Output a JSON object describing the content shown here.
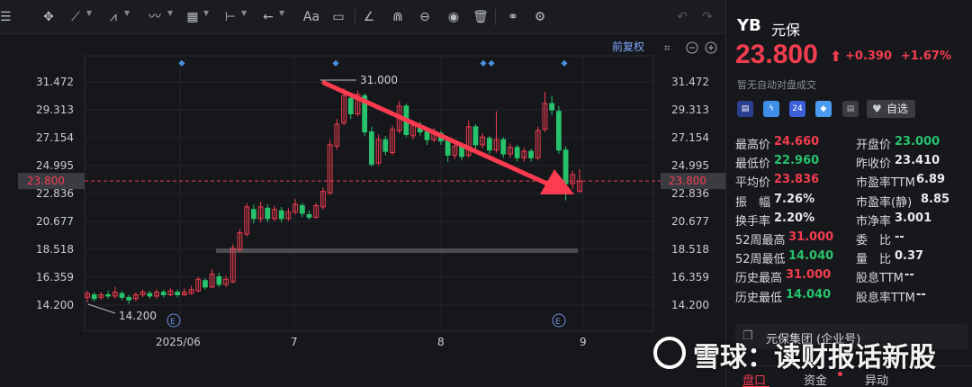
{
  "toolbar": {
    "text_tool_label": "Aa"
  },
  "chart": {
    "adjust_label": "前复权",
    "price_marker": "23.800",
    "max_label": "31.000",
    "min_label": "14.200",
    "event_marker": "E",
    "colors": {
      "up": "#f23d4f",
      "down": "#27c26b",
      "arrow": "#ff3b4f",
      "grid": "#23252b"
    }
  },
  "chart_data": {
    "type": "candlestick",
    "y_ticks_left": [
      "31.472",
      "29.313",
      "27.154",
      "24.995",
      "22.836",
      "20.677",
      "18.518",
      "16.359",
      "14.200"
    ],
    "y_ticks_right": [
      "31.472",
      "29.313",
      "27.154",
      "24.995",
      "22.836",
      "20.677",
      "18.518",
      "16.359",
      "14.200"
    ],
    "x_ticks": [
      "2025/06",
      "7",
      "8",
      "9"
    ],
    "ylim": [
      14.2,
      31.472
    ],
    "current_price": 23.8,
    "high_label": 31.0,
    "low_label": 14.2,
    "candles": [
      {
        "o": 14.8,
        "c": 15.1,
        "h": 15.3,
        "l": 14.4
      },
      {
        "o": 15.0,
        "c": 14.7,
        "h": 15.2,
        "l": 14.5
      },
      {
        "o": 14.8,
        "c": 15.0,
        "h": 15.2,
        "l": 14.6
      },
      {
        "o": 15.0,
        "c": 14.9,
        "h": 15.3,
        "l": 14.7
      },
      {
        "o": 14.9,
        "c": 15.2,
        "h": 15.6,
        "l": 14.7
      },
      {
        "o": 15.1,
        "c": 14.8,
        "h": 15.3,
        "l": 14.6
      },
      {
        "o": 14.8,
        "c": 14.6,
        "h": 15.0,
        "l": 14.3
      },
      {
        "o": 14.7,
        "c": 15.0,
        "h": 15.2,
        "l": 14.5
      },
      {
        "o": 15.0,
        "c": 15.2,
        "h": 15.4,
        "l": 14.8
      },
      {
        "o": 15.1,
        "c": 14.9,
        "h": 15.3,
        "l": 14.7
      },
      {
        "o": 14.9,
        "c": 15.2,
        "h": 15.4,
        "l": 14.7
      },
      {
        "o": 15.2,
        "c": 15.0,
        "h": 15.4,
        "l": 14.8
      },
      {
        "o": 15.0,
        "c": 15.3,
        "h": 15.5,
        "l": 14.9
      },
      {
        "o": 15.2,
        "c": 15.0,
        "h": 15.4,
        "l": 14.8
      },
      {
        "o": 15.0,
        "c": 15.2,
        "h": 15.5,
        "l": 14.9
      },
      {
        "o": 15.1,
        "c": 15.4,
        "h": 15.7,
        "l": 15.0
      },
      {
        "o": 15.3,
        "c": 16.2,
        "h": 16.4,
        "l": 15.2
      },
      {
        "o": 16.1,
        "c": 15.6,
        "h": 16.3,
        "l": 15.4
      },
      {
        "o": 15.6,
        "c": 16.6,
        "h": 17.0,
        "l": 15.5
      },
      {
        "o": 16.4,
        "c": 15.8,
        "h": 16.7,
        "l": 15.6
      },
      {
        "o": 15.8,
        "c": 16.2,
        "h": 16.5,
        "l": 15.6
      },
      {
        "o": 16.0,
        "c": 18.6,
        "h": 18.9,
        "l": 15.9
      },
      {
        "o": 18.5,
        "c": 19.8,
        "h": 20.1,
        "l": 18.3
      },
      {
        "o": 19.7,
        "c": 21.8,
        "h": 22.1,
        "l": 19.5
      },
      {
        "o": 21.6,
        "c": 20.9,
        "h": 22.0,
        "l": 20.5
      },
      {
        "o": 20.9,
        "c": 21.8,
        "h": 22.2,
        "l": 20.6
      },
      {
        "o": 21.7,
        "c": 20.9,
        "h": 22.0,
        "l": 20.6
      },
      {
        "o": 20.9,
        "c": 21.6,
        "h": 21.9,
        "l": 20.7
      },
      {
        "o": 21.5,
        "c": 20.9,
        "h": 21.8,
        "l": 20.6
      },
      {
        "o": 20.9,
        "c": 21.4,
        "h": 21.7,
        "l": 20.7
      },
      {
        "o": 21.4,
        "c": 22.0,
        "h": 22.4,
        "l": 21.2
      },
      {
        "o": 21.9,
        "c": 21.3,
        "h": 22.1,
        "l": 21.0
      },
      {
        "o": 21.2,
        "c": 21.0,
        "h": 21.5,
        "l": 20.8
      },
      {
        "o": 21.0,
        "c": 21.9,
        "h": 22.1,
        "l": 20.9
      },
      {
        "o": 21.8,
        "c": 23.0,
        "h": 23.3,
        "l": 21.6
      },
      {
        "o": 22.9,
        "c": 26.6,
        "h": 27.0,
        "l": 22.7
      },
      {
        "o": 26.5,
        "c": 28.2,
        "h": 28.6,
        "l": 26.2
      },
      {
        "o": 28.3,
        "c": 30.4,
        "h": 31.0,
        "l": 28.1
      },
      {
        "o": 30.2,
        "c": 29.0,
        "h": 30.5,
        "l": 28.6
      },
      {
        "o": 29.0,
        "c": 30.5,
        "h": 30.8,
        "l": 28.8
      },
      {
        "o": 30.4,
        "c": 27.6,
        "h": 30.6,
        "l": 27.3
      },
      {
        "o": 27.6,
        "c": 25.1,
        "h": 28.0,
        "l": 24.9
      },
      {
        "o": 25.2,
        "c": 27.0,
        "h": 27.4,
        "l": 25.0
      },
      {
        "o": 27.0,
        "c": 26.1,
        "h": 27.3,
        "l": 25.8
      },
      {
        "o": 26.0,
        "c": 27.8,
        "h": 28.1,
        "l": 25.8
      },
      {
        "o": 27.7,
        "c": 29.6,
        "h": 30.0,
        "l": 27.5
      },
      {
        "o": 29.6,
        "c": 27.4,
        "h": 29.8,
        "l": 27.2
      },
      {
        "o": 27.3,
        "c": 28.1,
        "h": 28.5,
        "l": 27.0
      },
      {
        "o": 28.1,
        "c": 27.6,
        "h": 28.4,
        "l": 27.3
      },
      {
        "o": 27.6,
        "c": 27.0,
        "h": 27.8,
        "l": 26.6
      },
      {
        "o": 27.0,
        "c": 27.6,
        "h": 27.9,
        "l": 26.8
      },
      {
        "o": 27.5,
        "c": 26.9,
        "h": 27.7,
        "l": 26.6
      },
      {
        "o": 26.9,
        "c": 25.8,
        "h": 27.1,
        "l": 25.3
      },
      {
        "o": 25.8,
        "c": 26.5,
        "h": 26.8,
        "l": 25.5
      },
      {
        "o": 26.5,
        "c": 25.7,
        "h": 26.7,
        "l": 25.4
      },
      {
        "o": 25.8,
        "c": 28.0,
        "h": 28.5,
        "l": 25.6
      },
      {
        "o": 28.0,
        "c": 26.6,
        "h": 28.2,
        "l": 26.3
      },
      {
        "o": 26.6,
        "c": 27.2,
        "h": 27.5,
        "l": 26.3
      },
      {
        "o": 27.1,
        "c": 26.2,
        "h": 27.3,
        "l": 25.9
      },
      {
        "o": 26.2,
        "c": 27.0,
        "h": 29.2,
        "l": 26.0
      },
      {
        "o": 27.0,
        "c": 25.9,
        "h": 27.2,
        "l": 25.6
      },
      {
        "o": 25.9,
        "c": 26.4,
        "h": 26.7,
        "l": 25.6
      },
      {
        "o": 26.4,
        "c": 25.6,
        "h": 26.6,
        "l": 25.3
      },
      {
        "o": 25.6,
        "c": 26.1,
        "h": 26.4,
        "l": 25.3
      },
      {
        "o": 26.1,
        "c": 25.6,
        "h": 26.3,
        "l": 25.3
      },
      {
        "o": 25.6,
        "c": 27.7,
        "h": 28.0,
        "l": 25.4
      },
      {
        "o": 27.8,
        "c": 29.8,
        "h": 30.7,
        "l": 27.6
      },
      {
        "o": 29.8,
        "c": 29.3,
        "h": 30.4,
        "l": 28.9
      },
      {
        "o": 29.2,
        "c": 26.2,
        "h": 29.6,
        "l": 25.9
      },
      {
        "o": 26.2,
        "c": 23.6,
        "h": 26.5,
        "l": 22.3
      },
      {
        "o": 23.6,
        "c": 24.3,
        "h": 24.6,
        "l": 23.2
      },
      {
        "o": 23.0,
        "c": 23.8,
        "h": 24.7,
        "l": 22.9
      }
    ]
  },
  "quote": {
    "code": "YB",
    "name": "元保",
    "price": "23.800",
    "arrow": "⬆",
    "change": "+0.390",
    "change_pct": "+1.67%",
    "note": "暂无自动对盘成交",
    "badge_24": "24",
    "fav_label": "自选",
    "stats_left": [
      {
        "label": "最高价",
        "value": "24.660",
        "color": "red"
      },
      {
        "label": "最低价",
        "value": "22.960",
        "color": "green"
      },
      {
        "label": "平均价",
        "value": "23.836",
        "color": "red"
      },
      {
        "label": "振　幅",
        "value": "7.26%",
        "color": "white"
      },
      {
        "label": "换手率",
        "value": "2.20%",
        "color": "white"
      },
      {
        "label": "52周最高",
        "value": "31.000",
        "color": "red"
      },
      {
        "label": "52周最低",
        "value": "14.040",
        "color": "green"
      },
      {
        "label": "历史最高",
        "value": "31.000",
        "color": "red"
      },
      {
        "label": "历史最低",
        "value": "14.040",
        "color": "green"
      }
    ],
    "stats_right": [
      {
        "label": "开盘价",
        "value": "23.000",
        "color": "green"
      },
      {
        "label": "昨收价",
        "value": "23.410",
        "color": "white"
      },
      {
        "label": "市盈率TTM",
        "value": "6.89",
        "color": "white"
      },
      {
        "label": "市盈率(静)",
        "value": "8.85",
        "color": "white"
      },
      {
        "label": "市净率",
        "value": "3.001",
        "color": "white"
      },
      {
        "label": "委　比",
        "value": "--",
        "color": "white"
      },
      {
        "label": "量　比",
        "value": "0.37",
        "color": "white"
      },
      {
        "label": "股息TTM",
        "value": "--",
        "color": "white"
      },
      {
        "label": "股息率TTM",
        "value": "--",
        "color": "white"
      }
    ],
    "org_name": "元保集团 (企业号)",
    "tabs": [
      "盘口",
      "资金",
      "异动"
    ]
  },
  "watermark": {
    "text": "雪球：读财报话新股"
  }
}
